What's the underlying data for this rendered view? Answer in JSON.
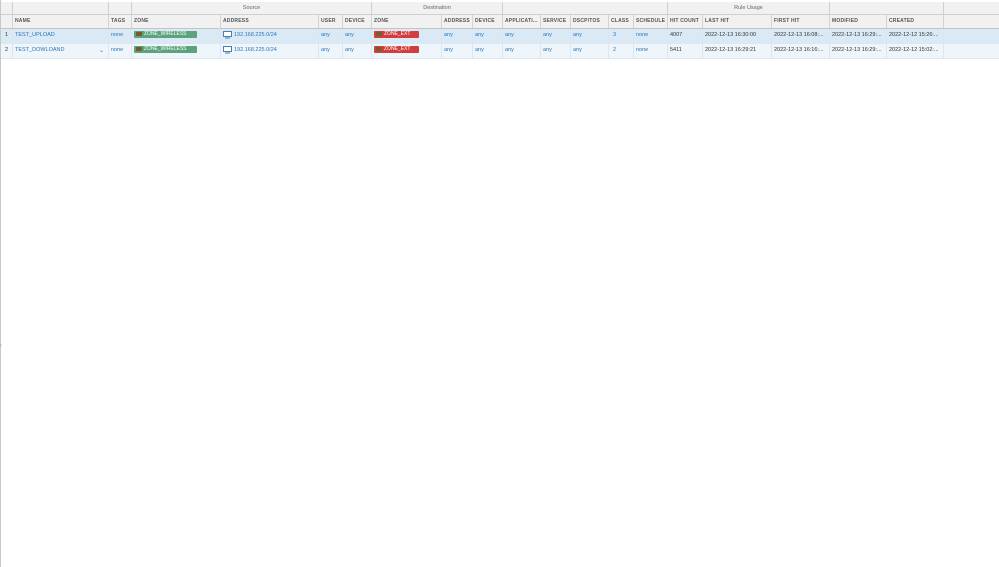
{
  "group_headers": {
    "source": "Source",
    "destination": "Destination",
    "rule_usage": "Rule Usage"
  },
  "columns": {
    "name": "NAME",
    "tags": "TAGS",
    "src_zone": "ZONE",
    "src_address": "ADDRESS",
    "user": "USER",
    "src_device": "DEVICE",
    "dst_zone": "ZONE",
    "dst_address": "ADDRESS",
    "dst_device": "DEVICE",
    "application": "APPLICATI...",
    "service": "SERVICE",
    "dscp": "DSCP/TOS",
    "class": "CLASS",
    "schedule": "SCHEDULE",
    "hit_count": "HIT COUNT",
    "last_hit": "LAST HIT",
    "first_hit": "FIRST HIT",
    "modified": "MODIFIED",
    "created": "CREATED"
  },
  "rows": [
    {
      "num": "1",
      "name": "TEST_UPLOAD",
      "tags": "none",
      "src_zone": "ZONE_WIRELESS",
      "src_address": "192.168.225.0/24",
      "user": "any",
      "src_device": "any",
      "dst_zone": "ZONE_EXT",
      "dst_address": "any",
      "dst_device": "any",
      "application": "any",
      "service": "any",
      "dscp": "any",
      "class": "3",
      "schedule": "none",
      "hit_count": "4007",
      "last_hit": "2022-12-13 16:30:00",
      "first_hit": "2022-12-13 16:08:...",
      "modified": "2022-12-13 16:29:...",
      "created": "2022-12-12 15:26:..."
    },
    {
      "num": "2",
      "name": "TEST_DOWLOAND",
      "tags": "none",
      "src_zone": "ZONE_WIRELESS",
      "src_address": "192.168.225.0/24",
      "user": "any",
      "src_device": "any",
      "dst_zone": "ZONE_EXT",
      "dst_address": "any",
      "dst_device": "any",
      "application": "any",
      "service": "any",
      "dscp": "any",
      "class": "2",
      "schedule": "none",
      "hit_count": "5411",
      "last_hit": "2022-12-13 16:29:21",
      "first_hit": "2022-12-13 16:16:...",
      "modified": "2022-12-13 16:29:...",
      "created": "2022-12-12 15:02:..."
    }
  ],
  "colors": {
    "src_zone_tag": "#5aa37d",
    "dst_zone_tag": "#d23d3d",
    "link": "#2d74b8",
    "selected_row": "#d9eaf6"
  },
  "icons": {
    "zone": "zone-icon",
    "address": "address-object-icon",
    "row_menu": "chevron-down-icon"
  }
}
